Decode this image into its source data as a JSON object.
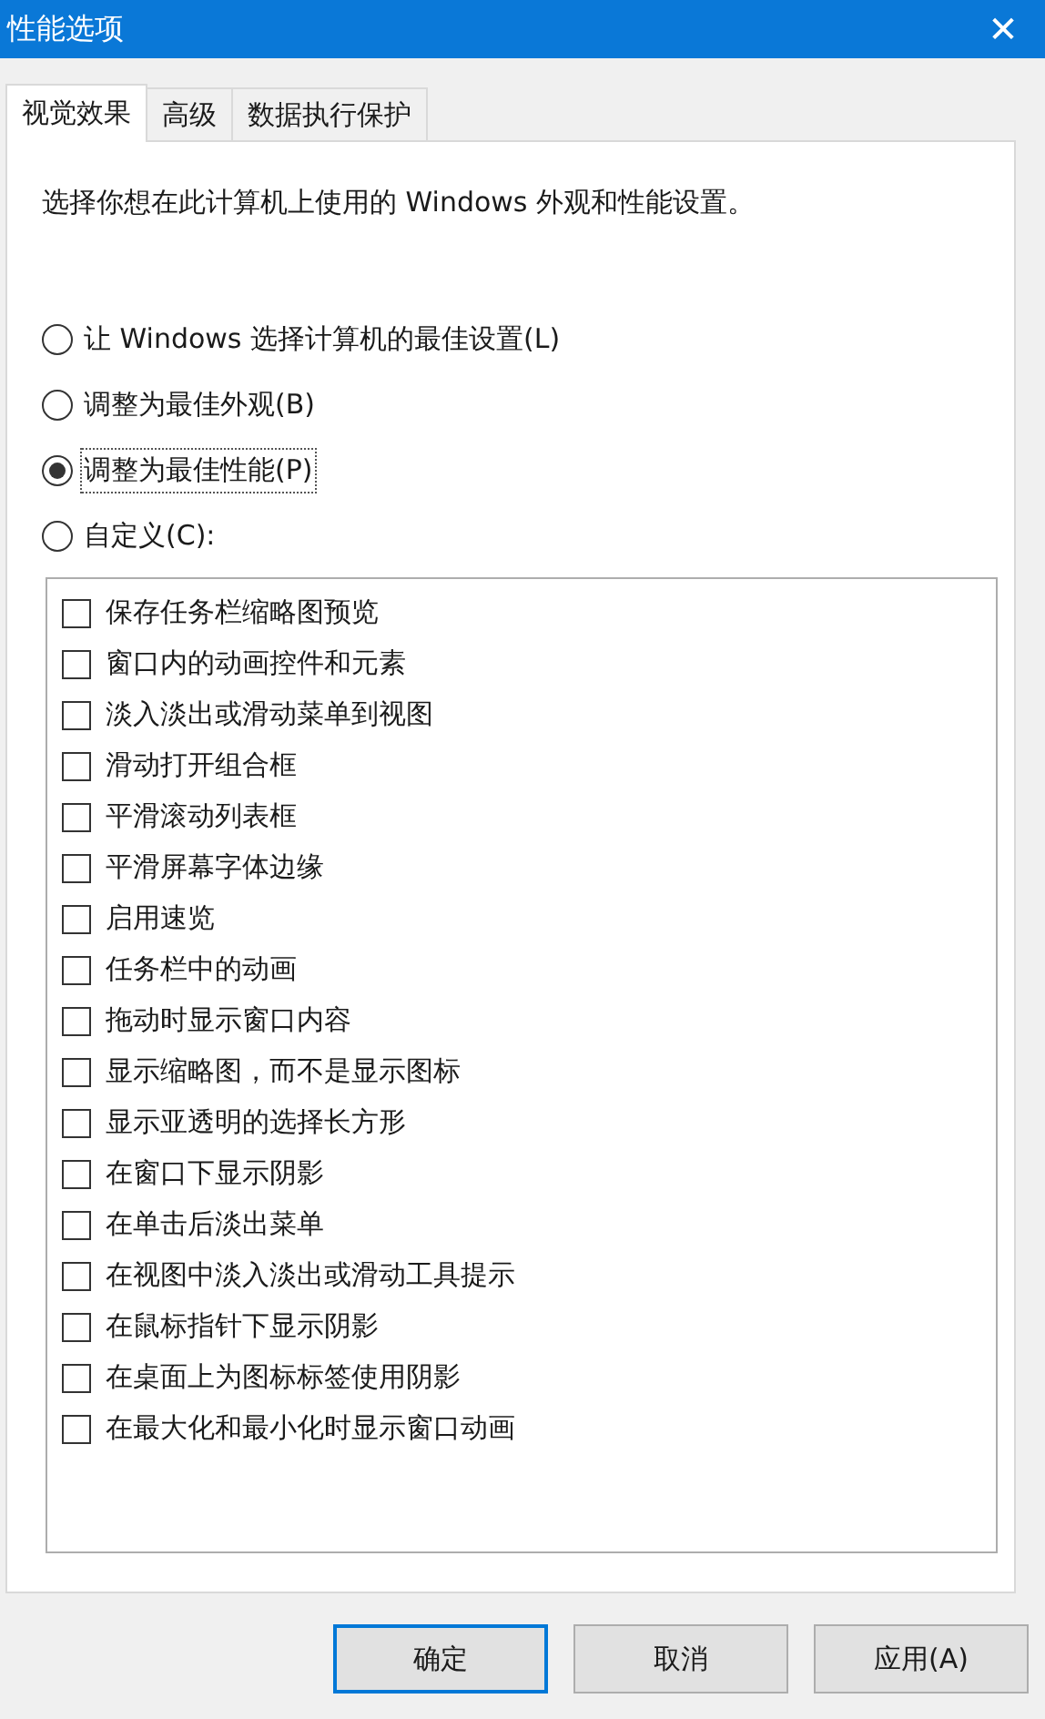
{
  "window": {
    "title": "性能选项",
    "close": "✕"
  },
  "tabs": [
    {
      "label": "视觉效果",
      "selected": true
    },
    {
      "label": "高级",
      "selected": false
    },
    {
      "label": "数据执行保护",
      "selected": false
    }
  ],
  "intro": "选择你想在此计算机上使用的 Windows 外观和性能设置。",
  "options": [
    {
      "label": "让 Windows 选择计算机的最佳设置(L)",
      "selected": false
    },
    {
      "label": "调整为最佳外观(B)",
      "selected": false
    },
    {
      "label": "调整为最佳性能(P)",
      "selected": true
    },
    {
      "label": "自定义(C):",
      "selected": false
    }
  ],
  "effects": [
    {
      "label": "保存任务栏缩略图预览",
      "checked": false
    },
    {
      "label": "窗口内的动画控件和元素",
      "checked": false
    },
    {
      "label": "淡入淡出或滑动菜单到视图",
      "checked": false
    },
    {
      "label": "滑动打开组合框",
      "checked": false
    },
    {
      "label": "平滑滚动列表框",
      "checked": false
    },
    {
      "label": "平滑屏幕字体边缘",
      "checked": false
    },
    {
      "label": "启用速览",
      "checked": false
    },
    {
      "label": "任务栏中的动画",
      "checked": false
    },
    {
      "label": "拖动时显示窗口内容",
      "checked": false
    },
    {
      "label": "显示缩略图，而不是显示图标",
      "checked": false
    },
    {
      "label": "显示亚透明的选择长方形",
      "checked": false
    },
    {
      "label": "在窗口下显示阴影",
      "checked": false
    },
    {
      "label": "在单击后淡出菜单",
      "checked": false
    },
    {
      "label": "在视图中淡入淡出或滑动工具提示",
      "checked": false
    },
    {
      "label": "在鼠标指针下显示阴影",
      "checked": false
    },
    {
      "label": "在桌面上为图标标签使用阴影",
      "checked": false
    },
    {
      "label": "在最大化和最小化时显示窗口动画",
      "checked": false
    }
  ],
  "buttons": [
    {
      "label": "确定",
      "default": true
    },
    {
      "label": "取消",
      "default": false
    },
    {
      "label": "应用(A)",
      "default": false
    }
  ]
}
